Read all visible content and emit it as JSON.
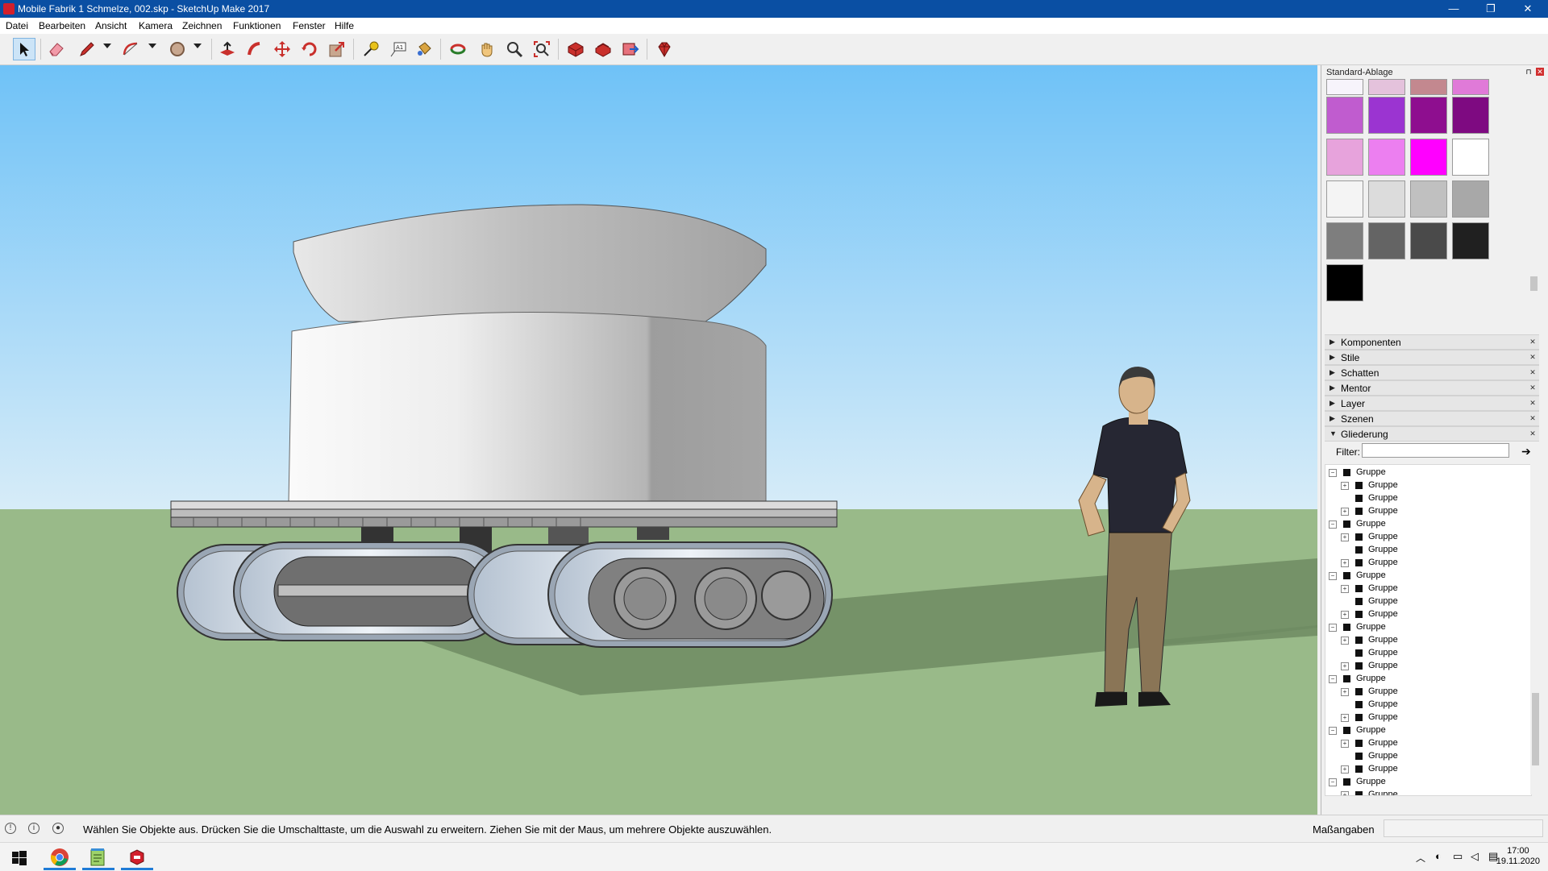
{
  "window": {
    "title": "Mobile Fabrik 1 Schmelze, 002.skp - SketchUp Make 2017",
    "minimize": "—",
    "restore": "❐",
    "close": "✕"
  },
  "menu": [
    "Datei",
    "Bearbeiten",
    "Ansicht",
    "Kamera",
    "Zeichnen",
    "Funktionen",
    "Fenster",
    "Hilfe"
  ],
  "toolbar": {
    "tools": [
      "select-tool",
      "eraser-tool",
      "pencil-tool",
      "arc-tool",
      "circle-tool",
      "push-pull-tool",
      "follow-me-tool",
      "move-tool",
      "rotate-tool",
      "scale-tool",
      "tape-measure-tool",
      "text-tool",
      "paint-bucket-tool",
      "orbit-tool",
      "pan-tool",
      "zoom-tool",
      "zoom-extents-tool",
      "3d-warehouse-tool",
      "extension-warehouse-tool",
      "layout-tool",
      "extension-manager-tool"
    ],
    "active": "select-tool"
  },
  "tray": {
    "title": "Standard-Ablage",
    "swatches": [
      [
        "#f7f4fb",
        "#e4c2dc",
        "#c3888f",
        "#e07ad8"
      ],
      [
        "#c05ccf",
        "#9b34d1",
        "#8e0e8f",
        "#7e0a81"
      ],
      [
        "#e7a3dc",
        "#ec7ff0",
        "#ff00ff",
        "#ffffff"
      ],
      [
        "#f4f4f4",
        "#dcdcdc",
        "#c0c0c0",
        "#a8a8a8"
      ],
      [
        "#7e7e7e",
        "#646464",
        "#4a4a4a",
        "#202020"
      ],
      [
        "#000000"
      ]
    ],
    "sections": [
      {
        "label": "Komponenten",
        "open": false
      },
      {
        "label": "Stile",
        "open": false
      },
      {
        "label": "Schatten",
        "open": false
      },
      {
        "label": "Mentor",
        "open": false
      },
      {
        "label": "Layer",
        "open": false
      },
      {
        "label": "Szenen",
        "open": false
      },
      {
        "label": "Gliederung",
        "open": true
      }
    ],
    "filter_label": "Filter:",
    "filter_value": "",
    "outliner": [
      {
        "label": "Gruppe",
        "children": [
          {
            "label": "Gruppe",
            "expandable": true
          },
          {
            "label": "Gruppe",
            "expandable": false
          },
          {
            "label": "Gruppe",
            "expandable": true
          }
        ]
      },
      {
        "label": "Gruppe",
        "children": [
          {
            "label": "Gruppe",
            "expandable": true
          },
          {
            "label": "Gruppe",
            "expandable": false
          },
          {
            "label": "Gruppe",
            "expandable": true
          }
        ]
      },
      {
        "label": "Gruppe",
        "children": [
          {
            "label": "Gruppe",
            "expandable": true
          },
          {
            "label": "Gruppe",
            "expandable": false
          },
          {
            "label": "Gruppe",
            "expandable": true
          }
        ]
      },
      {
        "label": "Gruppe",
        "children": [
          {
            "label": "Gruppe",
            "expandable": true
          },
          {
            "label": "Gruppe",
            "expandable": false
          },
          {
            "label": "Gruppe",
            "expandable": true
          }
        ]
      },
      {
        "label": "Gruppe",
        "children": [
          {
            "label": "Gruppe",
            "expandable": true
          },
          {
            "label": "Gruppe",
            "expandable": false
          },
          {
            "label": "Gruppe",
            "expandable": true
          }
        ]
      },
      {
        "label": "Gruppe",
        "children": [
          {
            "label": "Gruppe",
            "expandable": true
          },
          {
            "label": "Gruppe",
            "expandable": false
          },
          {
            "label": "Gruppe",
            "expandable": true
          }
        ]
      },
      {
        "label": "Gruppe",
        "children": [
          {
            "label": "Gruppe",
            "expandable": true
          }
        ]
      }
    ]
  },
  "status": {
    "message": "Wählen Sie Objekte aus. Drücken Sie die Umschalttaste, um die Auswahl zu erweitern. Ziehen Sie mit der Maus, um mehrere Objekte auszuwählen.",
    "measurements_label": "Maßangaben",
    "measurements_value": ""
  },
  "taskbar": {
    "apps": [
      "windows-start",
      "chrome",
      "notepad-app",
      "sketchup-app"
    ],
    "time": "17:00",
    "date": "19.11.2020"
  }
}
